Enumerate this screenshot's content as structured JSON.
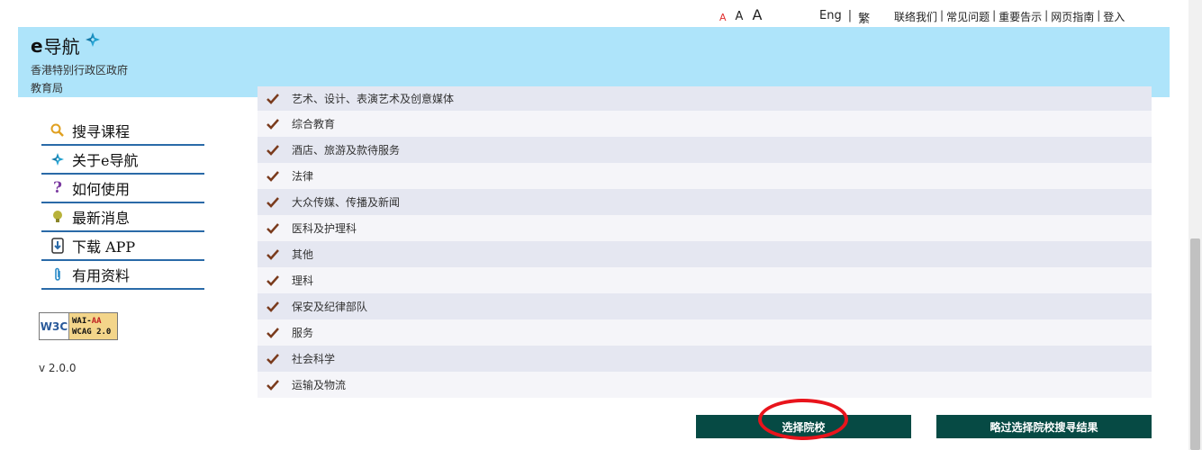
{
  "topbar": {
    "font_sizes": [
      "A",
      "A",
      "A"
    ],
    "lang": [
      "Eng",
      "繁"
    ],
    "links": [
      "联络我们",
      "常见问题",
      "重要告示",
      "网页指南",
      "登入"
    ]
  },
  "header": {
    "brand_e": "e",
    "brand_name": "导航",
    "gov": "香港特别行政区政府",
    "edb": "教育局"
  },
  "sidebar": {
    "items": [
      {
        "label": "搜寻课程",
        "icon": "search-icon"
      },
      {
        "label": "关于e导航",
        "icon": "compass-icon"
      },
      {
        "label": "如何使用",
        "icon": "question-icon"
      },
      {
        "label": "最新消息",
        "icon": "lightbulb-icon"
      },
      {
        "label": "下载 APP",
        "icon": "download-icon"
      },
      {
        "label": "有用资料",
        "icon": "paperclip-icon"
      }
    ],
    "wcag_left": "W3C",
    "wcag_line1_prefix": "WAI-",
    "wcag_line1_aa": "AA",
    "wcag_line2": "WCAG 2.0",
    "version": "v 2.0.0"
  },
  "categories": [
    "艺术、设计、表演艺术及创意媒体",
    "综合教育",
    "酒店、旅游及款待服务",
    "法律",
    "大众传媒、传播及新闻",
    "医科及护理科",
    "其他",
    "理科",
    "保安及纪律部队",
    "服务",
    "社会科学",
    "运输及物流"
  ],
  "buttons": {
    "select": "选择院校",
    "skip": "略过选择院校搜寻结果"
  },
  "colors": {
    "header_bg": "#aee4fa",
    "button_bg": "#064a44",
    "check": "#7a3b1d",
    "highlight": "#e8141c"
  }
}
